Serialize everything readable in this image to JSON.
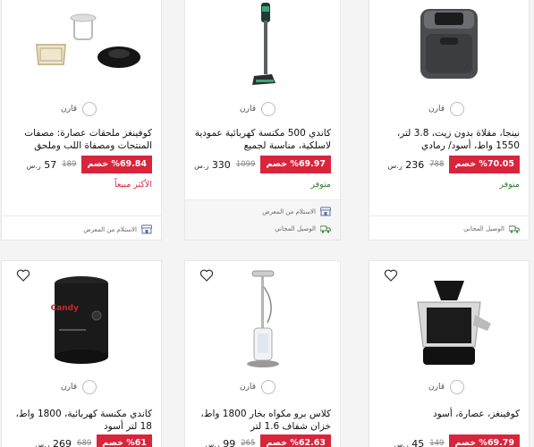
{
  "compare_label": "قارن",
  "currency": "ر.س",
  "products": [
    {
      "title": "نينجا، مقلاة بدون زيت، 3.8 لتر، 1550 واط، أسود/ رمادي",
      "discount": "%70.05 خصم",
      "price": "236",
      "old_price": "788",
      "status": "متوفر",
      "features": [
        "الوصيل المجاني"
      ]
    },
    {
      "title": "كاندي 500 مكنسة كهربائية عمودية لاسلكية، مناسبة لجميع",
      "discount": "%69.97 خصم",
      "price": "330",
      "old_price": "1099",
      "status": "متوفر",
      "features": [
        "الاستلام من المعرض",
        "الوصيل المجاني"
      ]
    },
    {
      "title": "كوفينغز ملحقات عصارة: مصفات المنتجات ومصفاة اللب وملحق",
      "discount": "%69.84 خصم",
      "price": "57",
      "old_price": "189",
      "status": "الأكثر مبيعاً",
      "features": [
        "الاستلام من المعرض"
      ]
    },
    {
      "title": "كوفينغز، عصارة، أسود",
      "discount": "%69.79 خصم",
      "price": "45",
      "old_price": "149"
    },
    {
      "title": "كلاس برو مكواه بخار 1800 واط، خزان شفاف 1.6 لتر",
      "discount": "%62.63 خصم",
      "price": "99",
      "old_price": "265"
    },
    {
      "title": "كاندي مكنسة كهربائية، 1800 واط، 18 لتر أسود",
      "discount": "%61 خصم",
      "price": "269",
      "old_price": "689"
    }
  ]
}
